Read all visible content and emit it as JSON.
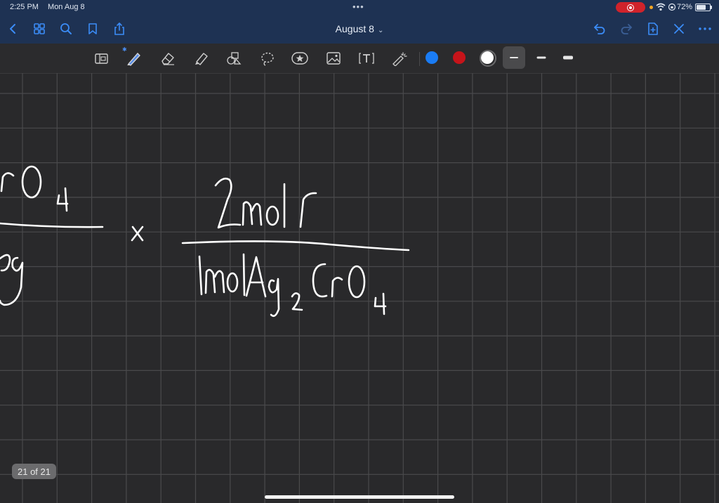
{
  "status_bar": {
    "time": "2:25 PM",
    "date": "Mon Aug 8",
    "battery_percent": "72%",
    "battery_level": 0.72,
    "recording": true
  },
  "nav_bar": {
    "title": "August 8",
    "icons": [
      "back-icon",
      "grid-thumbnails-icon",
      "search-icon",
      "bookmark-icon",
      "share-icon",
      "undo-icon",
      "redo-icon",
      "add-page-icon",
      "close-icon",
      "more-icon"
    ]
  },
  "toolbar": {
    "tools": [
      "page-view-icon",
      "pen-icon",
      "eraser-icon",
      "highlighter-icon",
      "shapes-icon",
      "lasso-icon",
      "sticker-icon",
      "image-icon",
      "text-icon",
      "laser-pointer-icon"
    ],
    "active_tool": "pen-icon",
    "colors": [
      "#1a7cf5",
      "#c6141a",
      "#ffffff"
    ],
    "selected_color": "#ffffff",
    "stroke_widths": [
      "thin",
      "medium",
      "thick"
    ],
    "selected_stroke": "thin"
  },
  "canvas": {
    "background": "#29292b",
    "grid_color": "#4a4a4c",
    "ink_color": "#ffffff",
    "handwriting": {
      "left_numerator": "rO",
      "left_numerator_subscript": "4",
      "left_denominator": "g",
      "operator": "x",
      "right_numerator": "2mol/",
      "right_denominator": "1mol Ag",
      "right_denominator_subscript_1": "2",
      "right_denominator_main": "CrO",
      "right_denominator_subscript_2": "4"
    }
  },
  "page_indicator": "21 of 21"
}
